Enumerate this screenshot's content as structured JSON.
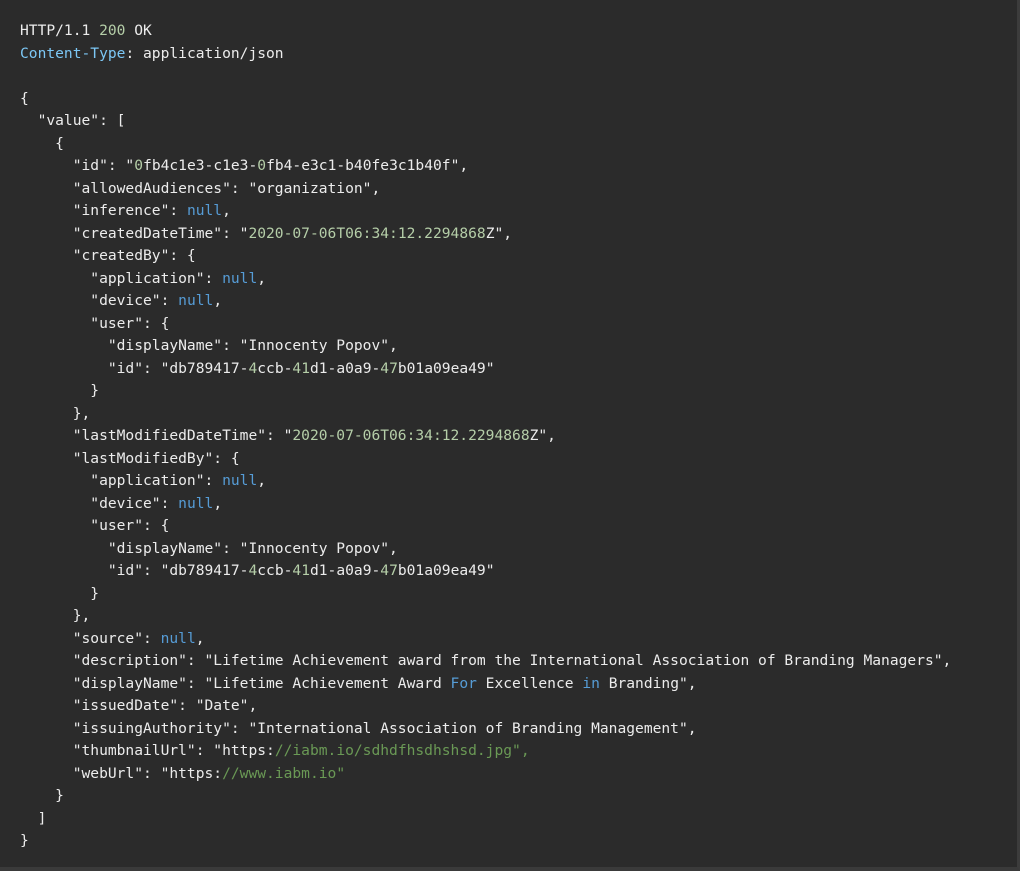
{
  "theme": {
    "background": "#2b2b2b",
    "text": "#ececec",
    "header_key": "#7cc7f5",
    "number": "#b5cea8",
    "keyword": "#569cd6",
    "string_highlight": "#b5cea8",
    "url_comment": "#6a9955"
  },
  "response": {
    "lines": [
      [
        {
          "t": "HTTP/1.1 "
        },
        {
          "t": "200",
          "c": "num"
        },
        {
          "t": " OK"
        }
      ],
      [
        {
          "t": "Content-Type",
          "c": "key"
        },
        {
          "t": ": application/json"
        }
      ],
      [],
      [
        {
          "t": "{"
        }
      ],
      [
        {
          "t": "  \"value\": ["
        }
      ],
      [
        {
          "t": "    {"
        }
      ],
      [
        {
          "t": "      \"id\": \""
        },
        {
          "t": "0",
          "c": "str"
        },
        {
          "t": "fb4c1e3-c1e3-"
        },
        {
          "t": "0",
          "c": "str"
        },
        {
          "t": "fb4-e3c1-b40fe3c1b40f\","
        }
      ],
      [
        {
          "t": "      \"allowedAudiences\": \"organization\","
        }
      ],
      [
        {
          "t": "      \"inference\": "
        },
        {
          "t": "null",
          "c": "kw"
        },
        {
          "t": ","
        }
      ],
      [
        {
          "t": "      \"createdDateTime\": \""
        },
        {
          "t": "2020-07-06T06:34:12.2294868",
          "c": "str"
        },
        {
          "t": "Z\","
        }
      ],
      [
        {
          "t": "      \"createdBy\": {"
        }
      ],
      [
        {
          "t": "        \"application\": "
        },
        {
          "t": "null",
          "c": "kw"
        },
        {
          "t": ","
        }
      ],
      [
        {
          "t": "        \"device\": "
        },
        {
          "t": "null",
          "c": "kw"
        },
        {
          "t": ","
        }
      ],
      [
        {
          "t": "        \"user\": {"
        }
      ],
      [
        {
          "t": "          \"displayName\": \"Innocenty Popov\","
        }
      ],
      [
        {
          "t": "          \"id\": \"db789417-"
        },
        {
          "t": "4",
          "c": "str"
        },
        {
          "t": "ccb-"
        },
        {
          "t": "41",
          "c": "str"
        },
        {
          "t": "d1-a0a9-"
        },
        {
          "t": "47",
          "c": "str"
        },
        {
          "t": "b01a09ea49\""
        }
      ],
      [
        {
          "t": "        }"
        }
      ],
      [
        {
          "t": "      },"
        }
      ],
      [
        {
          "t": "      \"lastModifiedDateTime\": \""
        },
        {
          "t": "2020-07-06T06:34:12.2294868",
          "c": "str"
        },
        {
          "t": "Z\","
        }
      ],
      [
        {
          "t": "      \"lastModifiedBy\": {"
        }
      ],
      [
        {
          "t": "        \"application\": "
        },
        {
          "t": "null",
          "c": "kw"
        },
        {
          "t": ","
        }
      ],
      [
        {
          "t": "        \"device\": "
        },
        {
          "t": "null",
          "c": "kw"
        },
        {
          "t": ","
        }
      ],
      [
        {
          "t": "        \"user\": {"
        }
      ],
      [
        {
          "t": "          \"displayName\": \"Innocenty Popov\","
        }
      ],
      [
        {
          "t": "          \"id\": \"db789417-"
        },
        {
          "t": "4",
          "c": "str"
        },
        {
          "t": "ccb-"
        },
        {
          "t": "41",
          "c": "str"
        },
        {
          "t": "d1-a0a9-"
        },
        {
          "t": "47",
          "c": "str"
        },
        {
          "t": "b01a09ea49\""
        }
      ],
      [
        {
          "t": "        }"
        }
      ],
      [
        {
          "t": "      },"
        }
      ],
      [
        {
          "t": "      \"source\": "
        },
        {
          "t": "null",
          "c": "kw"
        },
        {
          "t": ","
        }
      ],
      [
        {
          "t": "      \"description\": \"Lifetime Achievement award from the International Association of Branding Managers\","
        }
      ],
      [
        {
          "t": "      \"displayName\": \"Lifetime Achievement Award "
        },
        {
          "t": "For",
          "c": "kw"
        },
        {
          "t": " Excellence "
        },
        {
          "t": "in",
          "c": "kw"
        },
        {
          "t": " Branding\","
        }
      ],
      [
        {
          "t": "      \"issuedDate\": \"Date\","
        }
      ],
      [
        {
          "t": "      \"issuingAuthority\": \"International Association of Branding Management\","
        }
      ],
      [
        {
          "t": "      \"thumbnailUrl\": \"https:"
        },
        {
          "t": "//iabm.io/sdhdfhsdhshsd.jpg\",",
          "c": "url"
        }
      ],
      [
        {
          "t": "      \"webUrl\": \"https:"
        },
        {
          "t": "//www.iabm.io\"",
          "c": "url"
        }
      ],
      [
        {
          "t": "    }"
        }
      ],
      [
        {
          "t": "  ]"
        }
      ],
      [
        {
          "t": "}"
        }
      ]
    ]
  }
}
